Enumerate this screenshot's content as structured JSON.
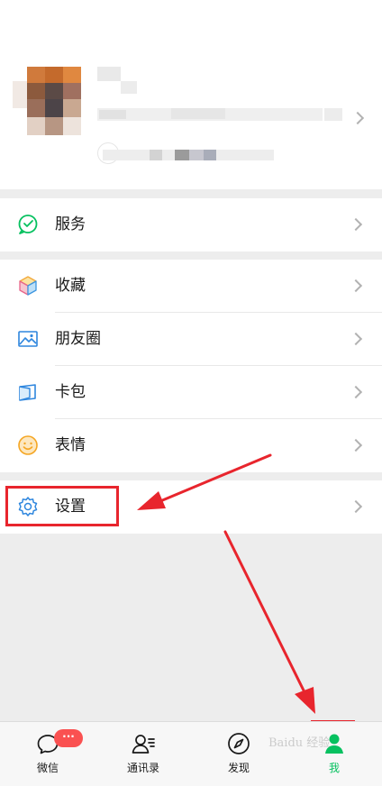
{
  "menu": {
    "services": {
      "label": "服务",
      "icon": "wechat-pay-icon"
    },
    "favorites": {
      "label": "收藏",
      "icon": "cube-icon"
    },
    "moments": {
      "label": "朋友圈",
      "icon": "picture-icon"
    },
    "cards": {
      "label": "卡包",
      "icon": "card-icon"
    },
    "stickers": {
      "label": "表情",
      "icon": "smile-icon"
    },
    "settings": {
      "label": "设置",
      "icon": "gear-icon"
    }
  },
  "tabbar": {
    "chats": {
      "label": "微信",
      "badge": "···"
    },
    "contacts": {
      "label": "通讯录"
    },
    "discover": {
      "label": "发现"
    },
    "me": {
      "label": "我"
    }
  },
  "watermark": "Baidu 经验",
  "colors": {
    "accent": "#07c160",
    "annotation": "#e8252d",
    "badge": "#fa5151"
  }
}
